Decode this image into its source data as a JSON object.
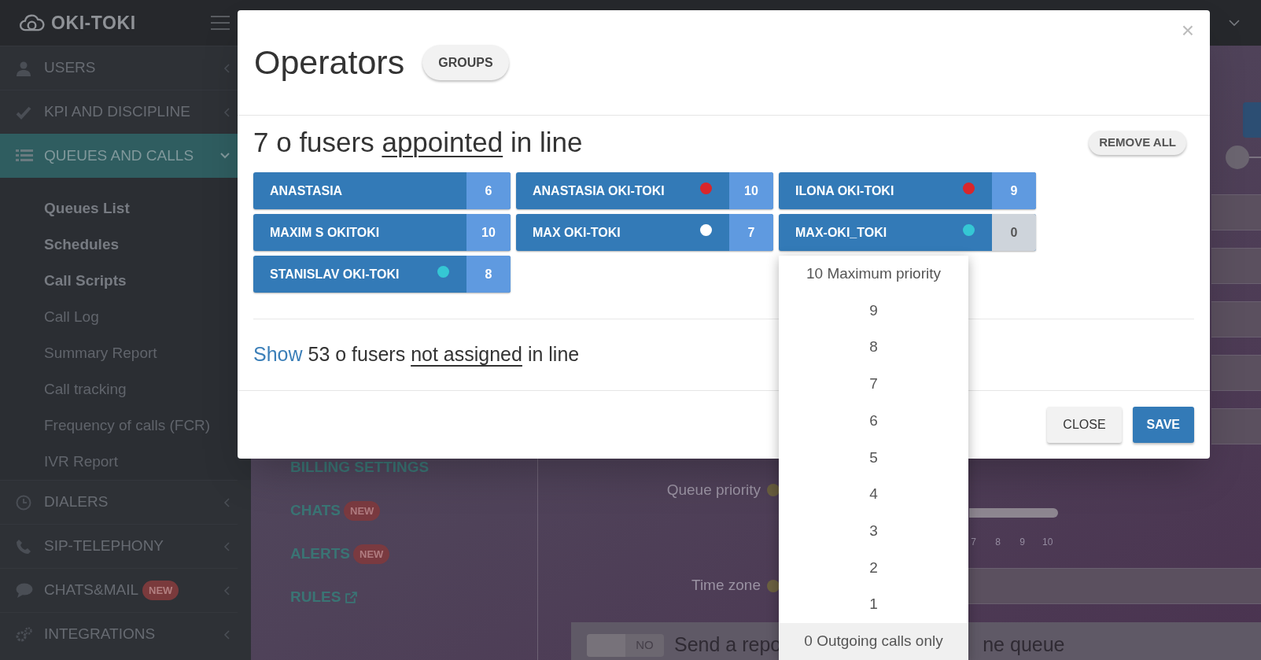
{
  "top_bar": {
    "logo": "OKI-TOKI"
  },
  "sidebar": {
    "items": [
      {
        "label": "USERS",
        "selected": false,
        "expanded": false
      },
      {
        "label": "KPI AND DISCIPLINE",
        "selected": false,
        "expanded": false
      },
      {
        "label": "QUEUES AND CALLS",
        "selected": true,
        "expanded": true,
        "children": [
          {
            "label": "Queues List",
            "emphasized": true
          },
          {
            "label": "Schedules",
            "emphasized": true
          },
          {
            "label": "Call Scripts",
            "emphasized": true
          },
          {
            "label": "Call Log",
            "emphasized": false
          },
          {
            "label": "Summary Report",
            "emphasized": false
          },
          {
            "label": "Call tracking",
            "emphasized": false
          },
          {
            "label": "Frequency of calls (FCR)",
            "emphasized": false
          },
          {
            "label": "IVR Report",
            "emphasized": false
          }
        ]
      },
      {
        "label": "DIALERS",
        "selected": false,
        "expanded": false
      },
      {
        "label": "SIP-TELEPHONY",
        "selected": false,
        "expanded": false
      },
      {
        "label": "CHATS&MAIL",
        "selected": false,
        "expanded": false,
        "badge": "NEW"
      },
      {
        "label": "INTEGRATIONS",
        "selected": false,
        "expanded": false
      }
    ]
  },
  "settings_nav": [
    {
      "label": "BILLING SETTINGS",
      "external": false
    },
    {
      "label": "CHATS",
      "badge": "NEW",
      "external": false
    },
    {
      "label": "ALERTS",
      "badge": "NEW",
      "external": false
    },
    {
      "label": "RULES",
      "external": true
    }
  ],
  "form": {
    "queue_priority_label": "Queue priority",
    "slider_ticks": [
      "7",
      "8",
      "9",
      "10"
    ],
    "time_zone_label": "Time zone",
    "report_toggle": {
      "label": "NO",
      "on": false
    },
    "report_text": [
      "Send a repo",
      "ne queue"
    ]
  },
  "modal": {
    "title": "Operators",
    "groups_button": "GROUPS",
    "close": "×",
    "heading": [
      {
        "text": "7 o fusers",
        "kind": "plain"
      },
      {
        "text": "appointed",
        "kind": "underlined"
      },
      {
        "text": "in line",
        "kind": "plain"
      }
    ],
    "remove_all": "REMOVE ALL",
    "operators": [
      {
        "name": "ANASTASIA",
        "priority": "6",
        "priority_open": false
      },
      {
        "name": "ANASTASIA OKI-TOKI",
        "priority": "10",
        "color": "#d9262b",
        "priority_open": false
      },
      {
        "name": "ILONA OKI-TOKI",
        "priority": "9",
        "color": "#d9262b",
        "priority_open": false
      },
      {
        "name": "MAXIM S OKITOKI",
        "priority": "10",
        "priority_open": false
      },
      {
        "name": "MAX OKI-TOKI",
        "priority": "7",
        "color": "#ffffff",
        "priority_open": false
      },
      {
        "name": "MAX-OKI_TOKI",
        "priority": "0",
        "color": "#35c7d4",
        "priority_open": true
      },
      {
        "name": "STANISLAV OKI-TOKI",
        "priority": "8",
        "color": "#35c7d4",
        "priority_open": false
      }
    ],
    "footer_text": [
      {
        "text": "Show",
        "kind": "link"
      },
      {
        "text": "53 o fusers",
        "kind": "plain"
      },
      {
        "text": "not assigned",
        "kind": "underlined"
      },
      {
        "text": "in line",
        "kind": "plain"
      }
    ],
    "buttons": [
      {
        "label": "CLOSE",
        "kind": "default"
      },
      {
        "label": "SAVE",
        "kind": "primary"
      }
    ]
  },
  "priority_dropdown": {
    "options": [
      {
        "label": "10 Maximum priority",
        "selected": false
      },
      {
        "label": "9",
        "selected": false
      },
      {
        "label": "8",
        "selected": false
      },
      {
        "label": "7",
        "selected": false
      },
      {
        "label": "6",
        "selected": false
      },
      {
        "label": "5",
        "selected": false
      },
      {
        "label": "4",
        "selected": false
      },
      {
        "label": "3",
        "selected": false
      },
      {
        "label": "2",
        "selected": false
      },
      {
        "label": "1",
        "selected": false
      },
      {
        "label": "0 Outgoing calls only",
        "selected": true
      }
    ]
  }
}
